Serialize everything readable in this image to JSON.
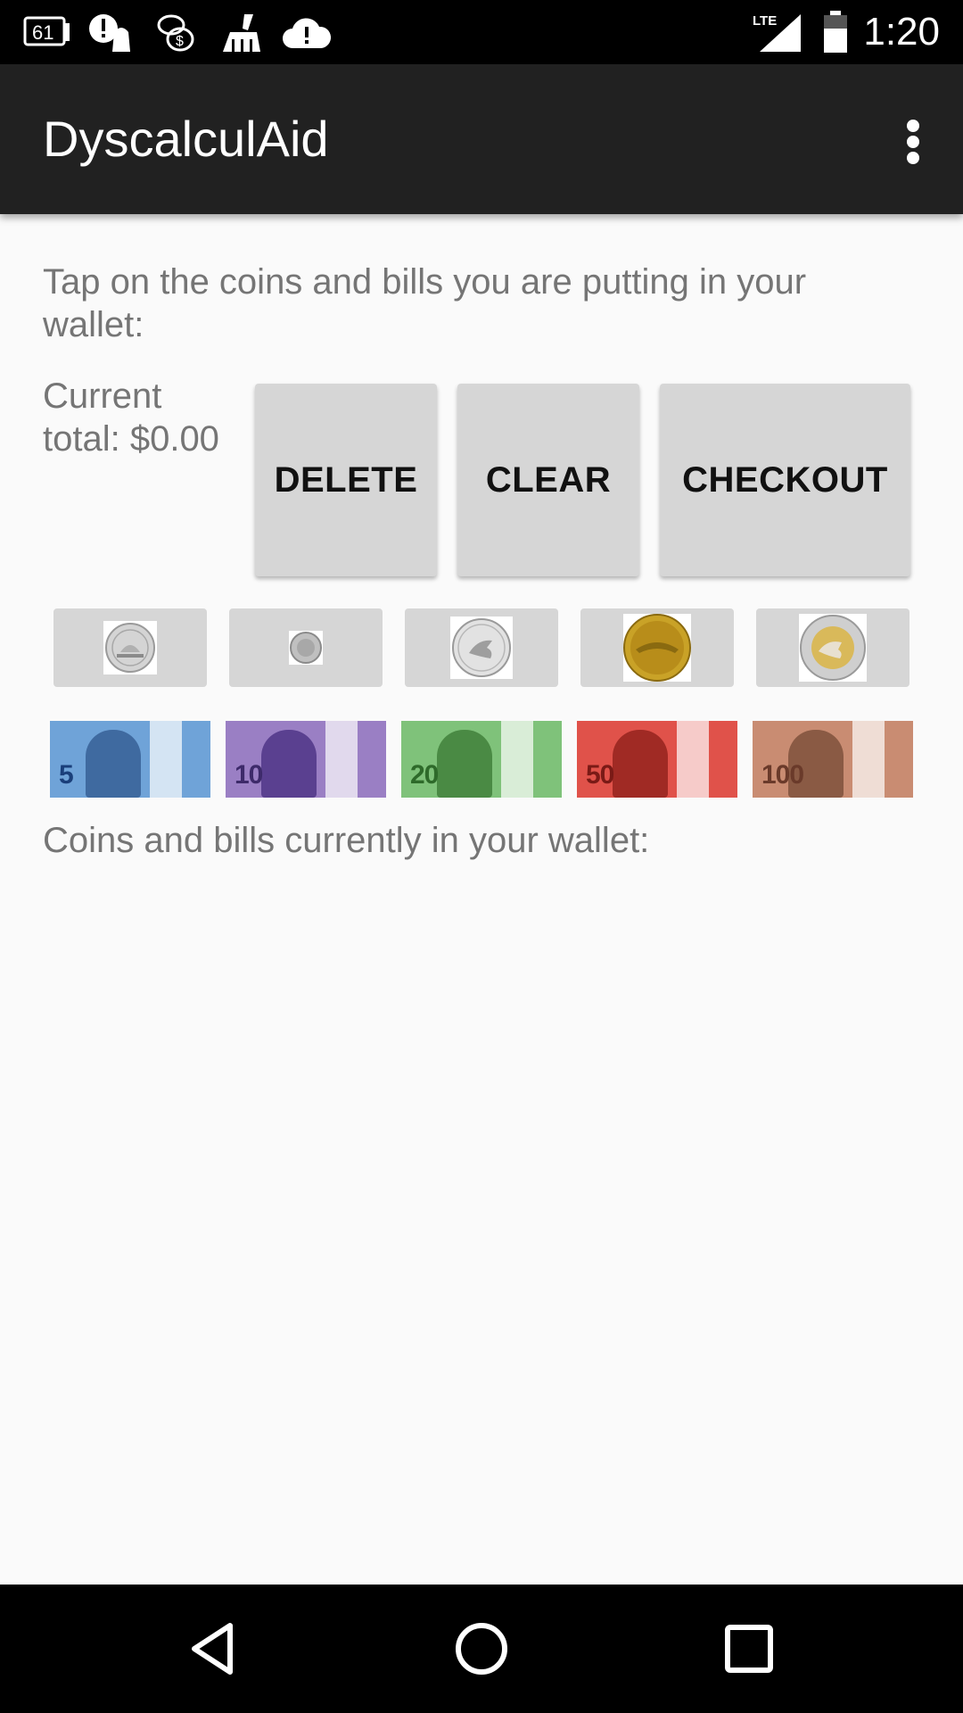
{
  "status_bar": {
    "time": "1:20",
    "notif_badge": "61",
    "network": "LTE",
    "icons": [
      "notification-61-icon",
      "alert-android-icon",
      "coins-icon",
      "broom-icon",
      "cloud-alert-icon",
      "lte-signal-icon",
      "battery-icon"
    ]
  },
  "app_bar": {
    "title": "DyscalculAid",
    "overflow_icon": "more-vert-icon"
  },
  "main": {
    "instructions": "Tap on the coins and bills you are putting in your wallet:",
    "total_label": "Current total: $0.00",
    "buttons": {
      "delete": "DELETE",
      "clear": "CLEAR",
      "checkout": "CHECKOUT"
    },
    "coins": [
      {
        "name": "nickel",
        "color": "#c8c8c8"
      },
      {
        "name": "dime",
        "color": "#bdbdbd"
      },
      {
        "name": "quarter",
        "color": "#d0d0d0"
      },
      {
        "name": "loonie",
        "color": "#c9a227"
      },
      {
        "name": "toonie",
        "color": "#d9c98a"
      }
    ],
    "bills": [
      {
        "denomination": "5",
        "color": "#6fa3d8",
        "text_color": "#1a3f7a"
      },
      {
        "denomination": "10",
        "color": "#9a7fc4",
        "text_color": "#3d2a6a"
      },
      {
        "denomination": "20",
        "color": "#7fc27a",
        "text_color": "#2e6a2a"
      },
      {
        "denomination": "50",
        "color": "#e0524a",
        "text_color": "#7a1a16"
      },
      {
        "denomination": "100",
        "color": "#c98c72",
        "text_color": "#6a3a2a"
      }
    ],
    "wallet_label": "Coins and bills currently in your wallet:"
  },
  "nav_bar": {
    "back": "back-icon",
    "home": "home-icon",
    "recents": "recents-icon"
  }
}
